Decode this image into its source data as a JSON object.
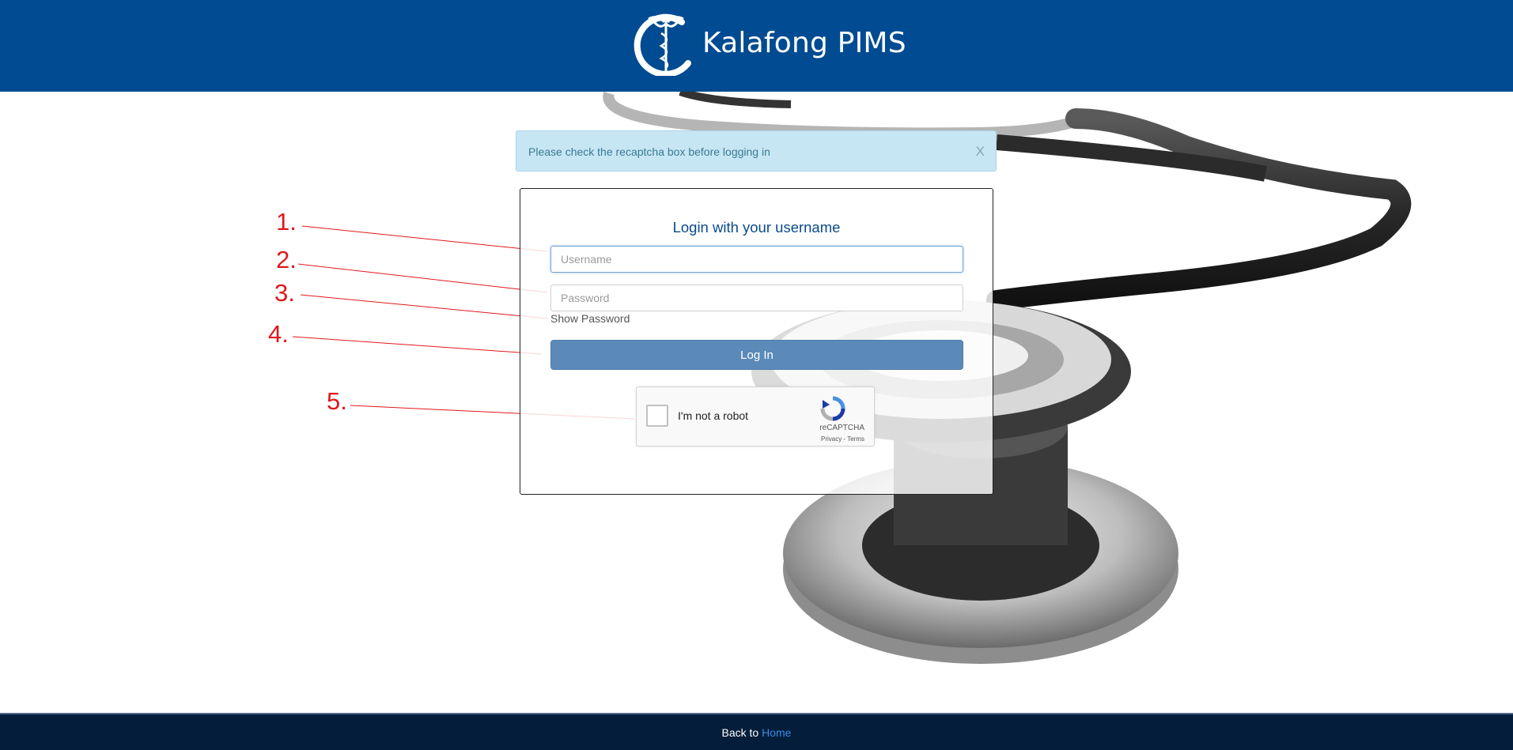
{
  "header": {
    "title": "Kalafong PIMS"
  },
  "alert": {
    "message": "Please check the recaptcha box before logging in",
    "close_label": "X"
  },
  "login": {
    "title": "Login with your username",
    "username_placeholder": "Username",
    "password_placeholder": "Password",
    "show_password_label": "Show Password",
    "login_button_label": "Log In"
  },
  "captcha": {
    "label": "I'm not a robot",
    "brand": "reCAPTCHA",
    "links": "Privacy - Terms"
  },
  "footer": {
    "prefix": "Back to ",
    "link_label": "Home"
  },
  "annotations": [
    "1.",
    "2.",
    "3.",
    "4.",
    "5."
  ],
  "colors": {
    "header": "#004b91",
    "footer": "#031d3a",
    "annotation": "#e0181c",
    "button": "#5b8ab9"
  }
}
